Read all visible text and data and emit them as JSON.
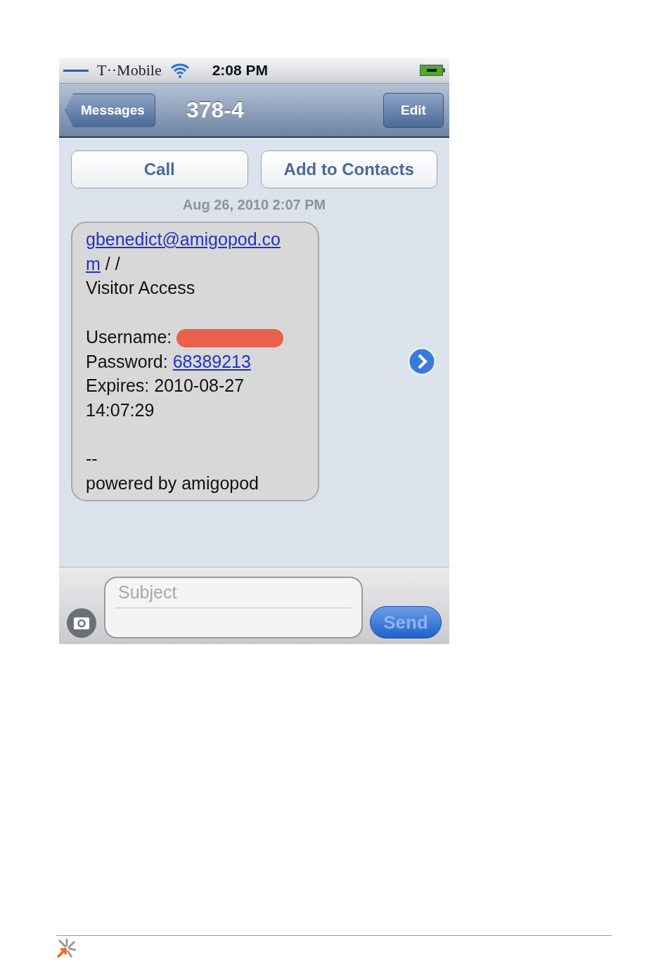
{
  "status_bar": {
    "carrier": "T··Mobile",
    "time": "2:08 PM"
  },
  "nav_bar": {
    "back": "Messages",
    "title": "378-4",
    "action": "Edit"
  },
  "actions": [
    "Call",
    "Add to Contacts"
  ],
  "timestamp": "Aug 26, 2010 2:07 PM",
  "message": {
    "lines": [
      {
        "kind": "text",
        "parts": [
          {
            "kind": "link",
            "text": "gbenedict@amigopod.co"
          }
        ]
      },
      {
        "kind": "text",
        "parts": [
          {
            "kind": "link",
            "text": "m"
          },
          {
            "kind": "plain",
            "text": " / /"
          }
        ]
      },
      {
        "kind": "text",
        "parts": [
          {
            "kind": "plain",
            "text": "Visitor Access"
          }
        ]
      },
      {
        "kind": "blank"
      },
      {
        "kind": "text",
        "parts": [
          {
            "kind": "plain",
            "text": "Username: "
          },
          {
            "kind": "redacted"
          }
        ]
      },
      {
        "kind": "text",
        "parts": [
          {
            "kind": "plain",
            "text": "Password: "
          },
          {
            "kind": "link",
            "text": "68389213"
          }
        ]
      },
      {
        "kind": "text",
        "parts": [
          {
            "kind": "plain",
            "text": "Expires: 2010-08-27"
          }
        ]
      },
      {
        "kind": "text",
        "parts": [
          {
            "kind": "plain",
            "text": "14:07:29"
          }
        ]
      },
      {
        "kind": "blank"
      },
      {
        "kind": "text",
        "parts": [
          {
            "kind": "plain",
            "text": "--"
          }
        ]
      },
      {
        "kind": "text",
        "parts": [
          {
            "kind": "plain",
            "text": "powered by amigopod"
          }
        ]
      }
    ]
  },
  "compose": {
    "placeholder": "Subject",
    "send": "Send"
  }
}
